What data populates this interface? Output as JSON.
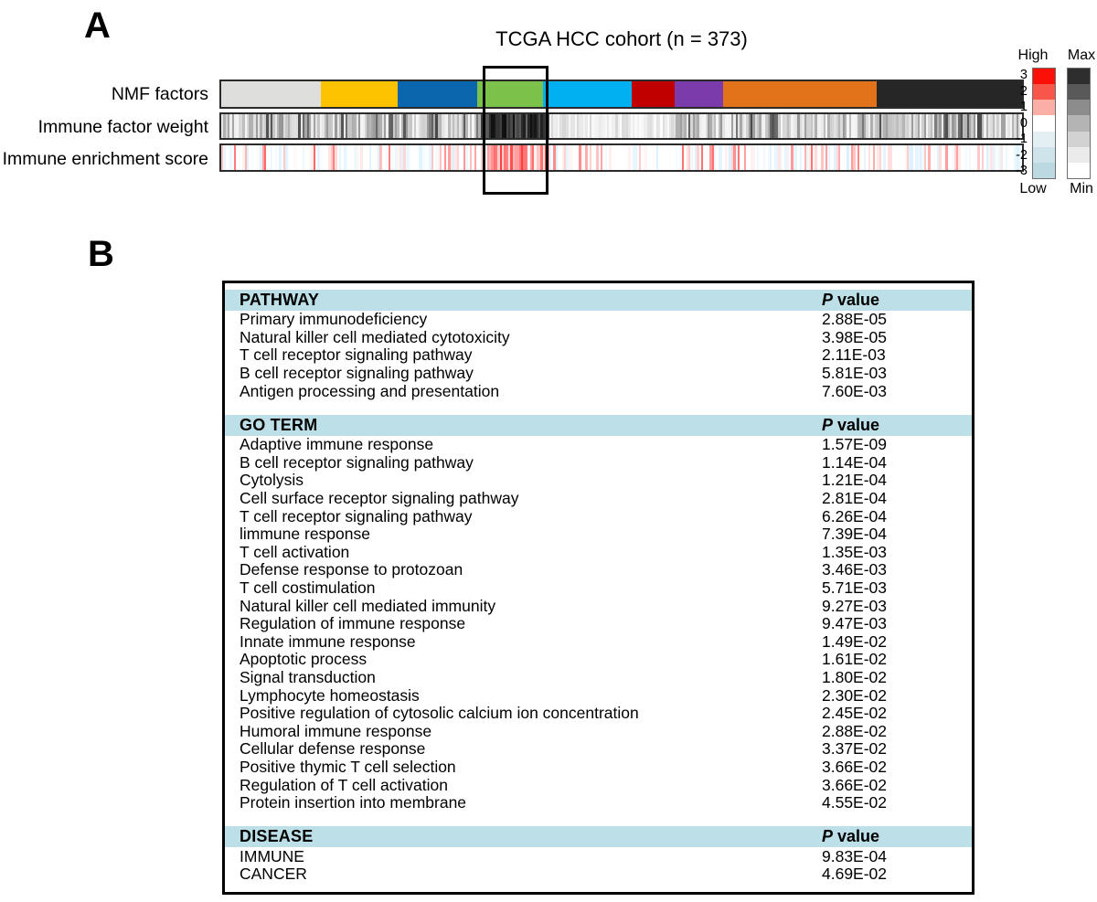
{
  "panels": {
    "a_letter": "A",
    "b_letter": "B"
  },
  "panel_a": {
    "title": "TCGA HCC cohort (n = 373)",
    "rows": [
      {
        "label": "NMF factors"
      },
      {
        "label": "Immune factor weight"
      },
      {
        "label": "Immune enrichment score"
      }
    ],
    "nmf_segments": [
      {
        "name": "factor-1",
        "color": "#dededd",
        "width_pct": 12.4
      },
      {
        "name": "factor-2",
        "color": "#fdc300",
        "width_pct": 9.6
      },
      {
        "name": "factor-3",
        "color": "#0c66ae",
        "width_pct": 10.0
      },
      {
        "name": "factor-4",
        "color": "#7cc24a",
        "width_pct": 8.2
      },
      {
        "name": "factor-5",
        "color": "#00b0f0",
        "width_pct": 11.1
      },
      {
        "name": "factor-6",
        "color": "#c00000",
        "width_pct": 5.3
      },
      {
        "name": "factor-7",
        "color": "#7b3bab",
        "width_pct": 6.1
      },
      {
        "name": "factor-8",
        "color": "#e3731a",
        "width_pct": 19.2
      },
      {
        "name": "factor-9",
        "color": "#262626",
        "width_pct": 18.1
      }
    ],
    "highlight_box": {
      "name": "selected-cluster-box"
    }
  },
  "legend_score": {
    "top_label": "High",
    "bottom_label": "Low",
    "ticks": [
      "3",
      "2",
      "1",
      "0",
      "-1",
      "-2",
      "-3"
    ],
    "colors": [
      "#fa1006",
      "#f8564a",
      "#fbaea6",
      "#ffffff",
      "#e3eff3",
      "#cfe4ea",
      "#bcd9e2"
    ]
  },
  "legend_weight": {
    "top_label": "Max",
    "bottom_label": "Min",
    "colors": [
      "#2e2e2e",
      "#595959",
      "#8c8c8c",
      "#b4b4b4",
      "#d2d2d2",
      "#ebebeb",
      "#ffffff"
    ]
  },
  "panel_b": {
    "p_value_header": "P value",
    "p_italic": "P",
    "p_rest": " value",
    "sections": [
      {
        "name": "pathway",
        "header": "PATHWAY",
        "rows": [
          {
            "term": "Primary immunodeficiency",
            "p": "2.88E-05"
          },
          {
            "term": "Natural killer cell mediated cytotoxicity",
            "p": "3.98E-05"
          },
          {
            "term": "T cell receptor signaling pathway",
            "p": "2.11E-03"
          },
          {
            "term": "B cell receptor signaling pathway",
            "p": "5.81E-03"
          },
          {
            "term": "Antigen processing and presentation",
            "p": "7.60E-03"
          }
        ]
      },
      {
        "name": "go-term",
        "header": "GO TERM",
        "rows": [
          {
            "term": "Adaptive immune response",
            "p": "1.57E-09"
          },
          {
            "term": "B cell receptor signaling pathway",
            "p": "1.14E-04"
          },
          {
            "term": "Cytolysis",
            "p": "1.21E-04"
          },
          {
            "term": "Cell surface receptor signaling pathway",
            "p": "2.81E-04"
          },
          {
            "term": "T cell receptor signaling pathway",
            "p": "6.26E-04"
          },
          {
            "term": "limmune response",
            "p": "7.39E-04"
          },
          {
            "term": "T cell activation",
            "p": "1.35E-03"
          },
          {
            "term": "Defense response to protozoan",
            "p": "3.46E-03"
          },
          {
            "term": "T cell costimulation",
            "p": "5.71E-03"
          },
          {
            "term": "Natural killer cell mediated immunity",
            "p": "9.27E-03"
          },
          {
            "term": "Regulation of immune response",
            "p": "9.47E-03"
          },
          {
            "term": "Innate immune response",
            "p": "1.49E-02"
          },
          {
            "term": "Apoptotic process",
            "p": "1.61E-02"
          },
          {
            "term": "Signal transduction",
            "p": "1.80E-02"
          },
          {
            "term": "Lymphocyte homeostasis",
            "p": "2.30E-02"
          },
          {
            "term": "Positive regulation of cytosolic calcium ion concentration",
            "p": "2.45E-02"
          },
          {
            "term": "Humoral immune response",
            "p": "2.88E-02"
          },
          {
            "term": "Cellular defense response",
            "p": "3.37E-02"
          },
          {
            "term": "Positive thymic T cell selection",
            "p": "3.66E-02"
          },
          {
            "term": "Regulation of T cell activation",
            "p": "3.66E-02"
          },
          {
            "term": "Protein insertion into membrane",
            "p": "4.55E-02"
          }
        ]
      },
      {
        "name": "disease",
        "header": "DISEASE",
        "rows": [
          {
            "term": "IMMUNE",
            "p": "9.83E-04"
          },
          {
            "term": "CANCER",
            "p": "4.69E-02"
          }
        ]
      }
    ]
  },
  "chart_data": {
    "type": "heatmap",
    "title": "TCGA HCC cohort (n = 373)",
    "n_samples": 373,
    "rows": [
      "NMF factors",
      "Immune factor weight",
      "Immune enrichment score"
    ],
    "nmf_factor_colors": [
      "#dededd",
      "#fdc300",
      "#0c66ae",
      "#7cc24a",
      "#00b0f0",
      "#c00000",
      "#7b3bab",
      "#e3731a",
      "#262626"
    ],
    "nmf_factor_width_pct": [
      12.4,
      9.6,
      10.0,
      8.2,
      11.1,
      5.3,
      6.1,
      19.2,
      18.1
    ],
    "immune_factor_weight_scale": {
      "label_max": "Max",
      "label_min": "Min",
      "colormap": "grayscale"
    },
    "immune_enrichment_scale": {
      "label_high": "High",
      "label_low": "Low",
      "ticks": [
        3,
        2,
        1,
        0,
        -1,
        -2,
        -3
      ],
      "colormap": "red-white-blue"
    },
    "highlight": {
      "target_factor_index": 3,
      "target_factor_color": "#7cc24a",
      "note": "boxed immune-high cluster"
    }
  }
}
